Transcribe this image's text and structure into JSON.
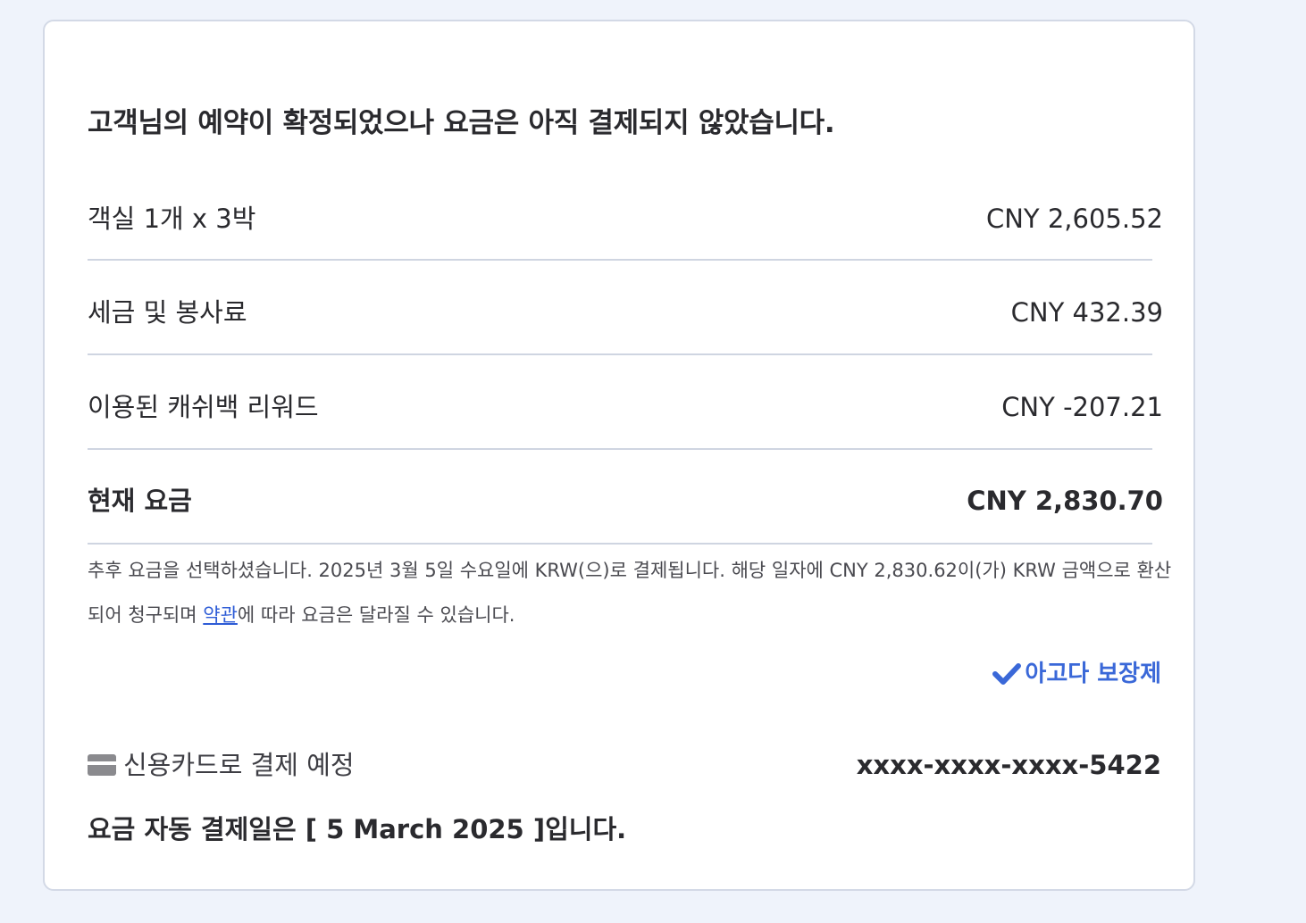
{
  "headline": "고객님의 예약이 확정되었으나 요금은 아직 결제되지 않았습니다.",
  "price_rows": [
    {
      "label": "객실 1개 x 3박",
      "value": "CNY 2,605.52"
    },
    {
      "label": "세금 및 봉사료",
      "value": "CNY 432.39"
    },
    {
      "label": "이용된 캐쉬백 리워드",
      "value": "CNY -207.21"
    }
  ],
  "total": {
    "label": "현재 요금",
    "value": "CNY 2,830.70"
  },
  "note": {
    "text_before_link": "추후 요금을 선택하셨습니다. 2025년 3월 5일 수요일에 KRW(으)로 결제됩니다. 해당 일자에 CNY 2,830.62이(가) KRW 금액으로 환산되어 청구되며 ",
    "link_text": "약관",
    "text_after_link": "에 따라 요금은 달라질 수 있습니다."
  },
  "guarantee": {
    "label": "아고다 보장제",
    "icon": "checkmark-icon",
    "color": "#3a68d8"
  },
  "payment": {
    "icon": "credit-card-icon",
    "label": "신용카드로 결제 예정",
    "card_number": "xxxx-xxxx-xxxx-5422"
  },
  "auto_pay": "요금 자동 결제일은 [ 5 March 2025 ]입니다."
}
